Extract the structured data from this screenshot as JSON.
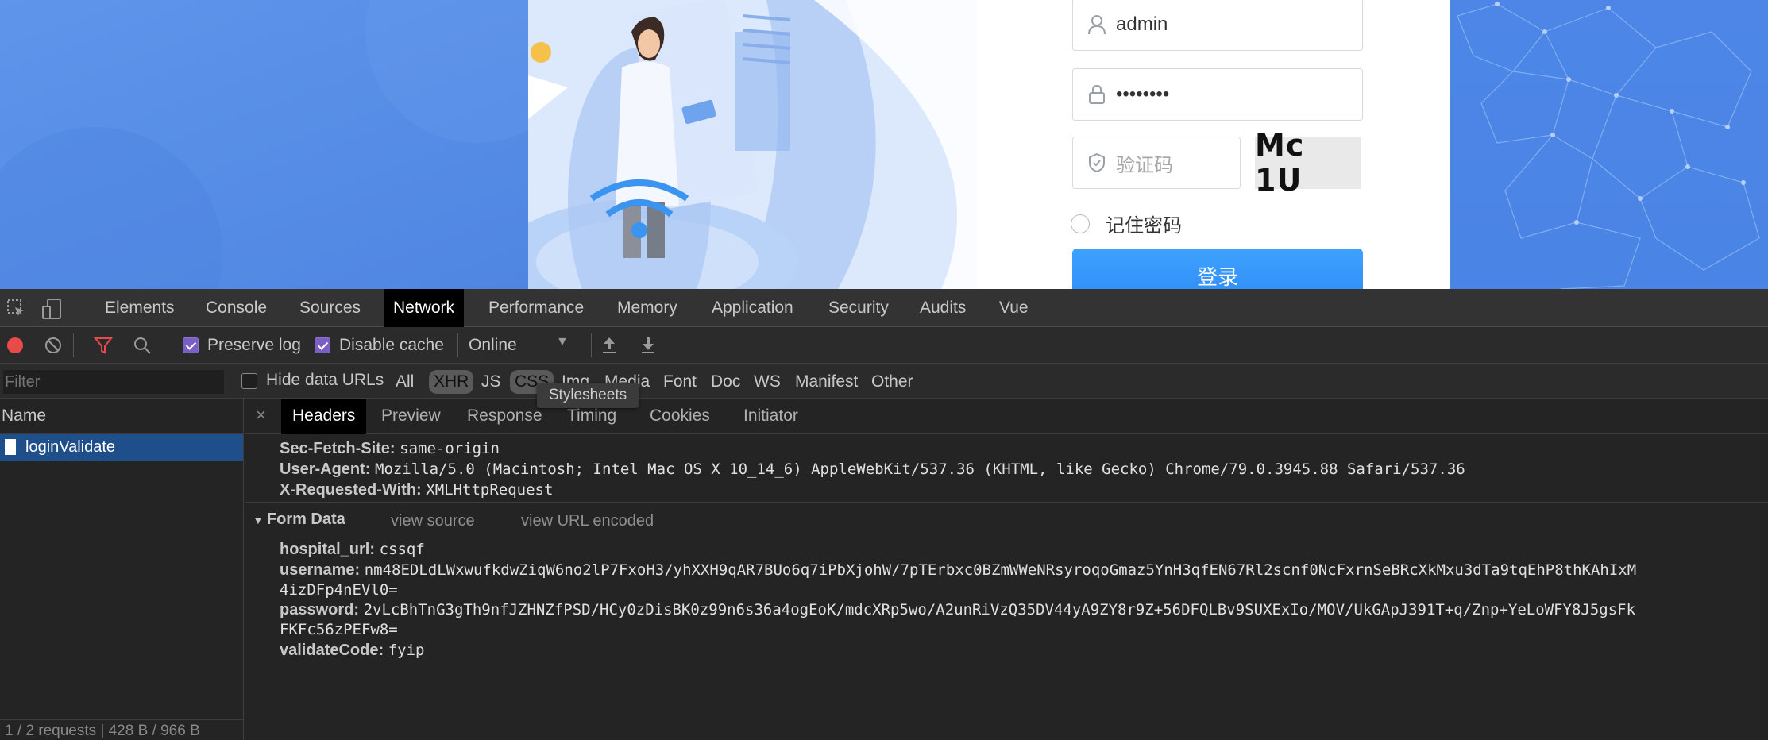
{
  "login": {
    "username_value": "admin",
    "password_value": "••••••••",
    "captcha_placeholder": "验证码",
    "captcha_text": "Mc 1U",
    "remember_label": "记住密码",
    "login_button": "登录"
  },
  "devtools": {
    "tabs": [
      "Elements",
      "Console",
      "Sources",
      "Network",
      "Performance",
      "Memory",
      "Application",
      "Security",
      "Audits",
      "Vue"
    ],
    "active_tab": "Network",
    "toolbar": {
      "preserve_log": "Preserve log",
      "disable_cache": "Disable cache",
      "throttle": "Online"
    },
    "filterbar": {
      "filter_placeholder": "Filter",
      "hide_data_urls": "Hide data URLs",
      "types": [
        "All",
        "XHR",
        "JS",
        "CSS",
        "Img",
        "Media",
        "Font",
        "Doc",
        "WS",
        "Manifest",
        "Other"
      ],
      "selected_types": [
        "XHR",
        "CSS"
      ],
      "tooltip": "Stylesheets"
    },
    "requests": {
      "name_header": "Name",
      "items": [
        "loginValidate"
      ],
      "footer": "1 / 2 requests | 428 B / 966 B"
    },
    "detail": {
      "tabs": [
        "Headers",
        "Preview",
        "Response",
        "Timing",
        "Cookies",
        "Initiator"
      ],
      "active_tab": "Headers",
      "request_headers": [
        {
          "key": "Sec-Fetch-Site:",
          "value": "same-origin"
        },
        {
          "key": "User-Agent:",
          "value": "Mozilla/5.0 (Macintosh; Intel Mac OS X 10_14_6) AppleWebKit/537.36 (KHTML, like Gecko) Chrome/79.0.3945.88 Safari/537.36"
        },
        {
          "key": "X-Requested-With:",
          "value": "XMLHttpRequest"
        }
      ],
      "form_data_title": "Form Data",
      "view_source": "view source",
      "view_url_encoded": "view URL encoded",
      "form_data": [
        {
          "key": "hospital_url:",
          "value": "cssqf"
        },
        {
          "key": "username:",
          "value": "nm48EDLdLWxwufkdwZiqW6no2lP7FxoH3/yhXXH9qAR7BUo6q7iPbXjohW/7pTErbxc0BZmWWeNRsyroqoGmaz5YnH3qfEN67Rl2scnf0NcFxrnSeBRcXkMxu3dTa9tqEhP8thKAhIxM",
          "value_cont": "4izDFp4nEVl0="
        },
        {
          "key": "password:",
          "value": "2vLcBhTnG3gTh9nfJZHNZfPSD/HCy0zDisBK0z99n6s36a4ogEoK/mdcXRp5wo/A2unRiVzQ35DV44yA9ZY8r9Z+56DFQLBv9SUXExIo/MOV/UkGApJ391T+q/Znp+YeLoWFY8J5gsFk",
          "value_cont": "FKFc56zPEFw8="
        },
        {
          "key": "validateCode:",
          "value": "fyip"
        }
      ]
    }
  }
}
